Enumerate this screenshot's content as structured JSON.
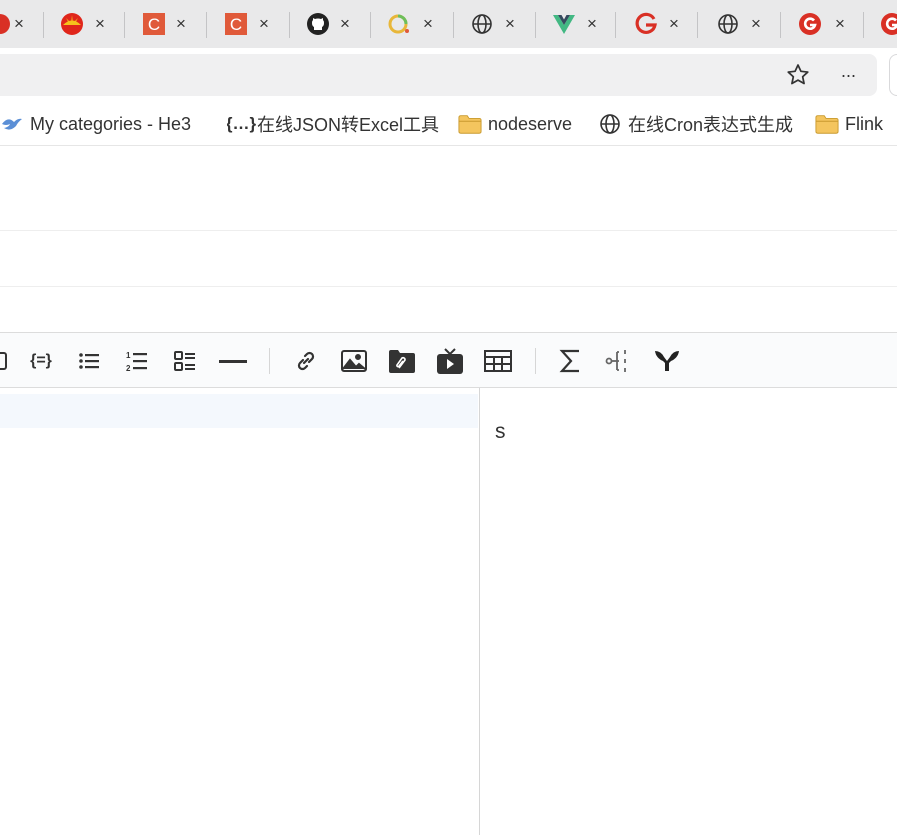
{
  "tabs": [
    {
      "favicon": "red-circle-icon",
      "close": "×"
    },
    {
      "favicon": "petrochina-icon",
      "close": "×"
    },
    {
      "favicon": "csdn-c-icon",
      "close": "×"
    },
    {
      "favicon": "csdn-c-icon",
      "close": "×"
    },
    {
      "favicon": "github-icon",
      "close": "×"
    },
    {
      "favicon": "loading-ring-icon",
      "close": "×"
    },
    {
      "favicon": "globe-icon",
      "close": "×"
    },
    {
      "favicon": "vue-icon",
      "close": "×"
    },
    {
      "favicon": "g-letter-icon",
      "close": "×"
    },
    {
      "favicon": "globe-icon",
      "close": "×"
    },
    {
      "favicon": "g-circle-icon",
      "close": "×"
    },
    {
      "favicon": "g-circle-icon",
      "close": ""
    }
  ],
  "address_bar": {
    "url": "",
    "favorite_icon": "star-icon",
    "more_icon": "ellipsis-icon",
    "more_label": "···"
  },
  "bookmarks": [
    {
      "icon": "swallow-icon",
      "label": "My categories - He3"
    },
    {
      "icon": "json-braces-icon",
      "label": "在线JSON转Excel工具"
    },
    {
      "icon": "folder-icon",
      "label": "nodeserve"
    },
    {
      "icon": "globe-icon",
      "label": "在线Cron表达式生成"
    },
    {
      "icon": "folder-icon",
      "label": "Flink"
    }
  ],
  "editor_toolbar": {
    "buttons": [
      "code-block-icon",
      "code-inline-icon",
      "unordered-list-icon",
      "ordered-list-icon",
      "task-list-icon",
      "horizontal-rule-icon",
      "link-icon",
      "image-icon",
      "attachment-icon",
      "video-icon",
      "table-icon",
      "formula-icon",
      "mindmap-icon",
      "flowchart-icon"
    ],
    "code_inline_label": "{=}"
  },
  "editor": {
    "content": ""
  },
  "preview": {
    "content": "s"
  },
  "colors": {
    "tabstrip_bg": "#e9e9ea",
    "csdn_red": "#e05a3a",
    "vue_green": "#42b883",
    "google_red": "#d93025",
    "folder_yellow": "#f4c55e",
    "active_line_bg": "#f4f8fd"
  }
}
